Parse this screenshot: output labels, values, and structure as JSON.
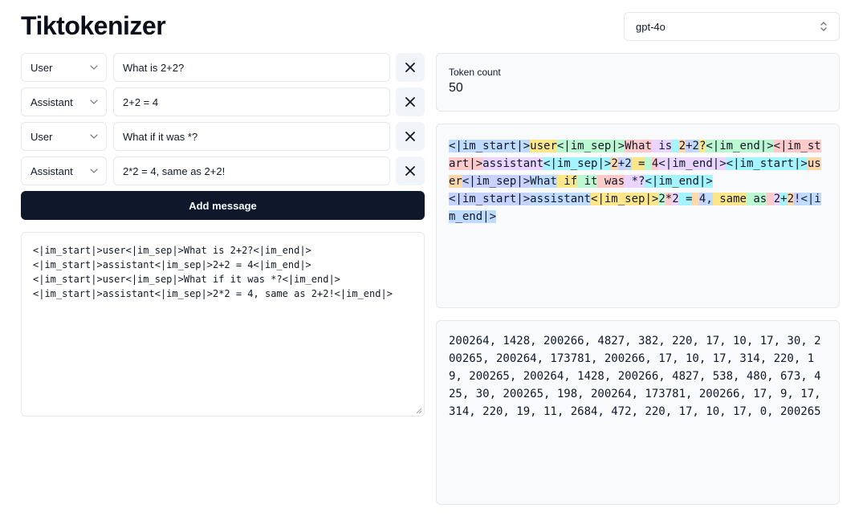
{
  "app": {
    "title": "Tiktokenizer"
  },
  "model_select": {
    "value": "gpt-4o",
    "icon": "chevron-up-down-icon"
  },
  "messages": [
    {
      "role": "User",
      "content": "What is 2+2?"
    },
    {
      "role": "Assistant",
      "content": "2+2 = 4"
    },
    {
      "role": "User",
      "content": "What if it was *?"
    },
    {
      "role": "Assistant",
      "content": "2*2 = 4, same as 2+2!"
    }
  ],
  "remove_icon": "close-icon",
  "add_message": {
    "label": "Add message"
  },
  "raw_prompt": {
    "lines": [
      "<|im_start|>user<|im_sep|>What is 2+2?<|im_end|>",
      "<|im_start|>assistant<|im_sep|>2+2 = 4<|im_end|>",
      "<|im_start|>user<|im_sep|>What if it was *?<|im_end|>",
      "<|im_start|>assistant<|im_sep|>2*2 = 4, same as 2+2!<|im_end|>"
    ]
  },
  "token_count": {
    "label": "Token count",
    "value": "50"
  },
  "token_palette": [
    "#bfdbfe",
    "#fde68a",
    "#bbf7d0",
    "#fecaca",
    "#e9d5ff",
    "#a5f3fc",
    "#fed7aa",
    "#c7d2fe"
  ],
  "tokens": [
    "<|im_start|>",
    "user",
    "<|im_sep|>",
    "What",
    " is",
    " ",
    "2",
    "+",
    "2",
    "?",
    "<|im_end|>",
    "<|im_start|>",
    "assistant",
    "<|im_sep|>",
    "2",
    "+",
    "2",
    " =",
    " ",
    "4",
    "<|im_end|>",
    "<|im_start|>",
    "user",
    "<|im_sep|>",
    "What",
    " if",
    " it",
    " was",
    " *?",
    "<|im_end|>",
    "\n",
    "<|im_start|>",
    "assistant",
    "<|im_sep|>",
    "2",
    "*",
    "2",
    " =",
    " ",
    "4",
    ",",
    " same",
    " as",
    " ",
    "2",
    "+",
    "2",
    "!",
    "<|im_end|>"
  ],
  "token_ids": "200264, 1428, 200266, 4827, 382, 220, 17, 10, 17, 30, 200265, 200264, 173781, 200266, 17, 10, 17, 314, 220, 19, 200265, 200264, 1428, 200266, 4827, 538, 480, 673, 425, 30, 200265, 198, 200264, 173781, 200266, 17, 9, 17, 314, 220, 19, 11, 2684, 472, 220, 17, 10, 17, 0, 200265"
}
